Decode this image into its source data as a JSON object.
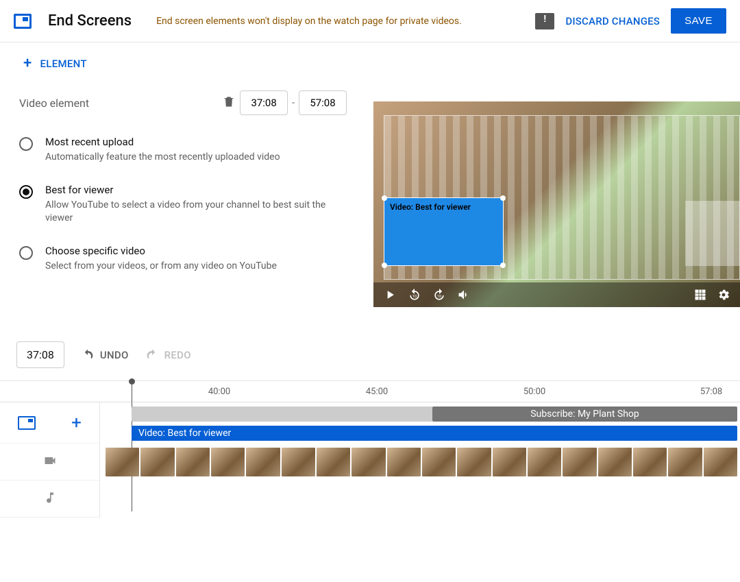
{
  "header": {
    "title": "End Screens",
    "warning": "End screen elements won't display on the watch page for private videos.",
    "discard": "DISCARD CHANGES",
    "save": "SAVE"
  },
  "left": {
    "add_element": "ELEMENT",
    "video_element_label": "Video element",
    "time_start": "37:08",
    "time_end": "57:08",
    "dash": "-",
    "options": [
      {
        "title": "Most recent upload",
        "desc": "Automatically feature the most recently uploaded video",
        "selected": false
      },
      {
        "title": "Best for viewer",
        "desc": "Allow YouTube to select a video from your channel to best suit the viewer",
        "selected": true
      },
      {
        "title": "Choose specific video",
        "desc": "Select from your videos, or from any video on YouTube",
        "selected": false
      }
    ]
  },
  "preview": {
    "card_label": "Video: Best for viewer"
  },
  "timeline": {
    "position": "37:08",
    "undo": "UNDO",
    "redo": "REDO",
    "ruler": [
      "40:00",
      "45:00",
      "50:00",
      "57:08"
    ],
    "subscribe_clip": "Subscribe: My Plant Shop",
    "video_clip": "Video: Best for viewer"
  }
}
